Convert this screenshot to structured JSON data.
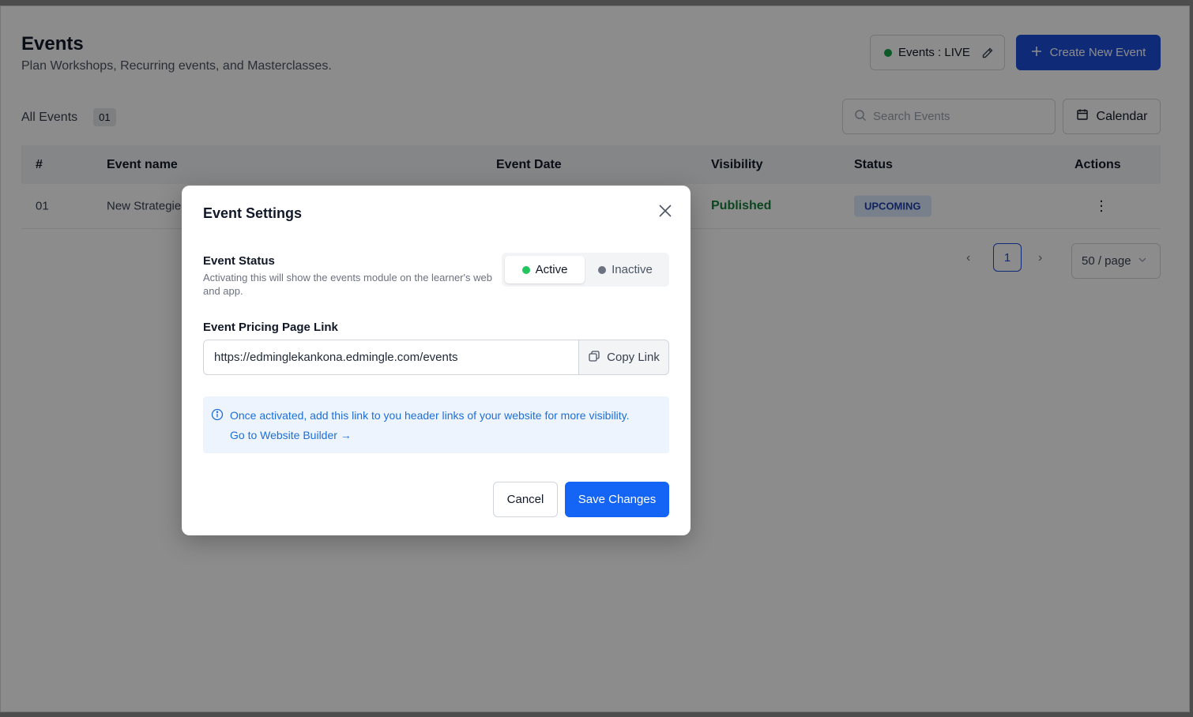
{
  "header": {
    "title": "Events",
    "subtitle": "Plan Workshops, Recurring events, and Masterclasses.",
    "live_label": "Events : LIVE",
    "create_label": "Create New Event"
  },
  "toolbar": {
    "all_events_label": "All Events",
    "count": "01",
    "search_placeholder": "Search Events",
    "calendar_label": "Calendar"
  },
  "table": {
    "columns": [
      "#",
      "Event name",
      "Event Date",
      "Visibility",
      "Status",
      "Actions"
    ],
    "rows": [
      {
        "num": "01",
        "name": "New Strategie",
        "visibility": "Published",
        "status": "UPCOMING"
      }
    ]
  },
  "pagination": {
    "current_page": "1",
    "page_size": "50 / page"
  },
  "modal": {
    "title": "Event Settings",
    "status_label": "Event Status",
    "status_desc": "Activating this will show the events module on the learner's web and app.",
    "active_label": "Active",
    "inactive_label": "Inactive",
    "link_label": "Event Pricing Page Link",
    "link_value": "https://edminglekankona.edmingle.com/events",
    "copy_label": "Copy Link",
    "info_text": "Once activated, add this link to you header links of your website for more visibility.",
    "info_link": "Go to Website Builder →",
    "cancel_label": "Cancel",
    "save_label": "Save Changes"
  },
  "colors": {
    "primary": "#1d4ed8",
    "save": "#1464f5",
    "live_green": "#16a34a",
    "info_bg": "#eef4fd",
    "info_text": "#1d6fd6"
  }
}
